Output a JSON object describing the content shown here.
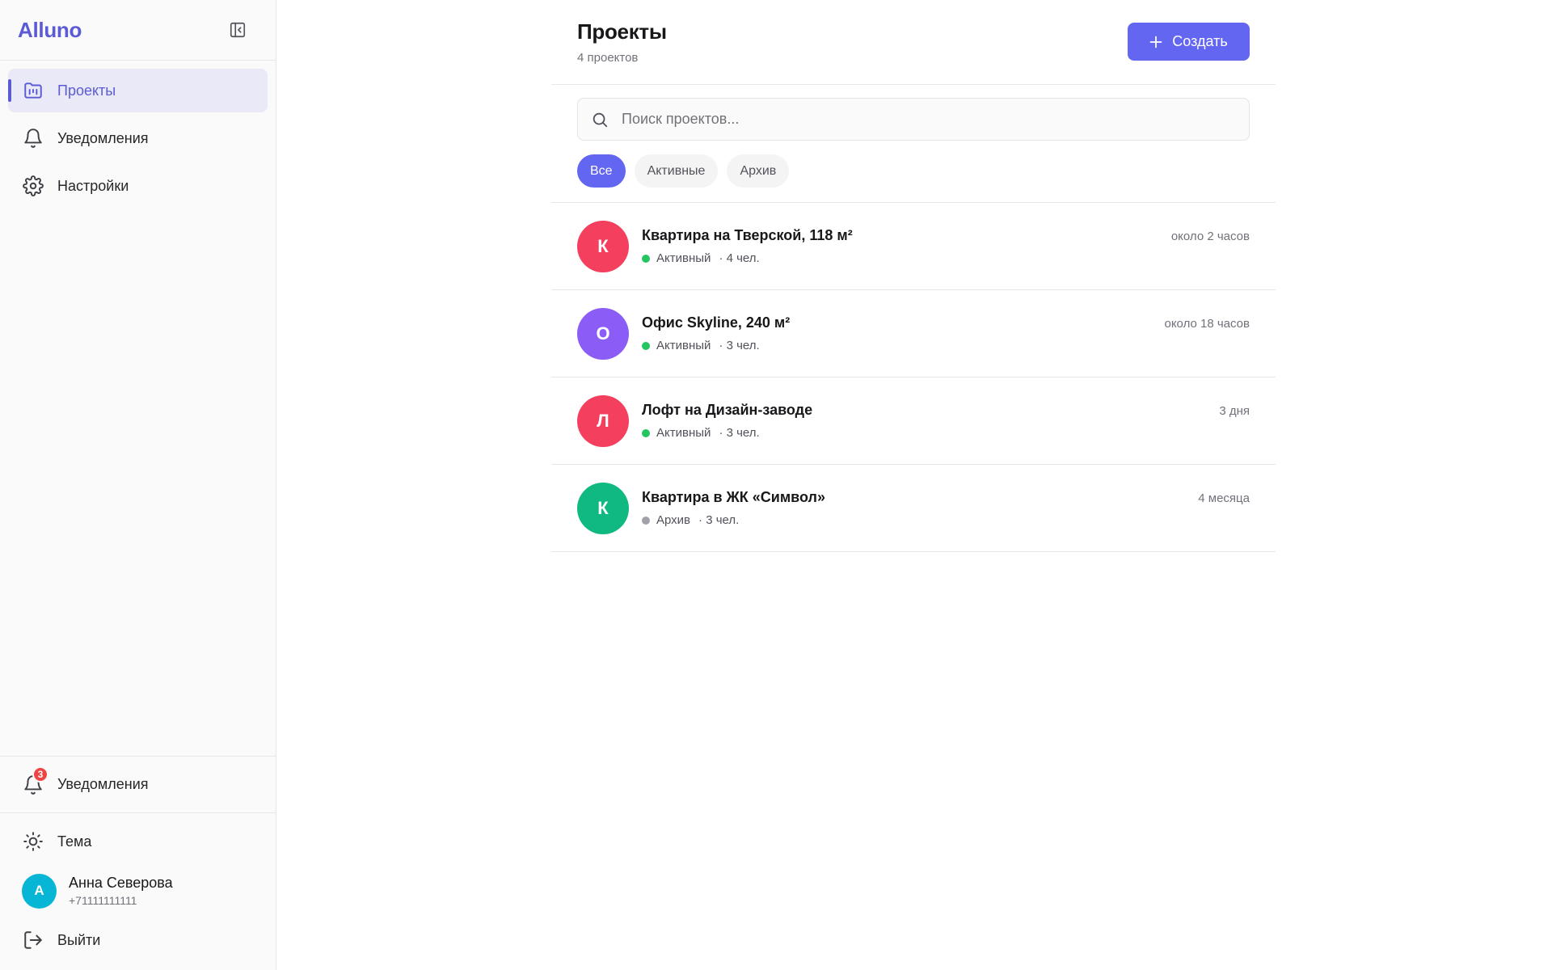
{
  "app": {
    "logo": "Alluno"
  },
  "sidebar": {
    "items": [
      {
        "label": "Проекты",
        "icon": "folder-icon",
        "active": true
      },
      {
        "label": "Уведомления",
        "icon": "bell-icon",
        "active": false
      },
      {
        "label": "Настройки",
        "icon": "gear-icon",
        "active": false
      }
    ],
    "notifications": {
      "label": "Уведомления",
      "badge": "3"
    },
    "theme": {
      "label": "Тема"
    },
    "user": {
      "initial": "А",
      "name": "Анна Северова",
      "phone": "+71111111111"
    },
    "logout": {
      "label": "Выйти"
    }
  },
  "header": {
    "title": "Проекты",
    "subtitle": "4 проектов",
    "create_label": "Создать"
  },
  "search": {
    "placeholder": "Поиск проектов..."
  },
  "filters": [
    {
      "label": "Все",
      "active": true
    },
    {
      "label": "Активные",
      "active": false
    },
    {
      "label": "Архив",
      "active": false
    }
  ],
  "projects": [
    {
      "initial": "К",
      "color": "#f43f5e",
      "name": "Квартира на Тверской, 118 м²",
      "status": "Активный",
      "status_color": "#22c55e",
      "members": "· 4 чел.",
      "time": "около 2 часов"
    },
    {
      "initial": "О",
      "color": "#8b5cf6",
      "name": "Офис Skyline, 240 м²",
      "status": "Активный",
      "status_color": "#22c55e",
      "members": "· 3 чел.",
      "time": "около 18 часов"
    },
    {
      "initial": "Л",
      "color": "#f43f5e",
      "name": "Лофт на Дизайн-заводе",
      "status": "Активный",
      "status_color": "#22c55e",
      "members": "· 3 чел.",
      "time": "3 дня"
    },
    {
      "initial": "К",
      "color": "#10b981",
      "name": "Квартира в ЖК «Символ»",
      "status": "Архив",
      "status_color": "#a1a1aa",
      "members": "· 3 чел.",
      "time": "4 месяца"
    }
  ],
  "colors": {
    "accent": "#6366f1",
    "brand": "#5b5bd6"
  }
}
